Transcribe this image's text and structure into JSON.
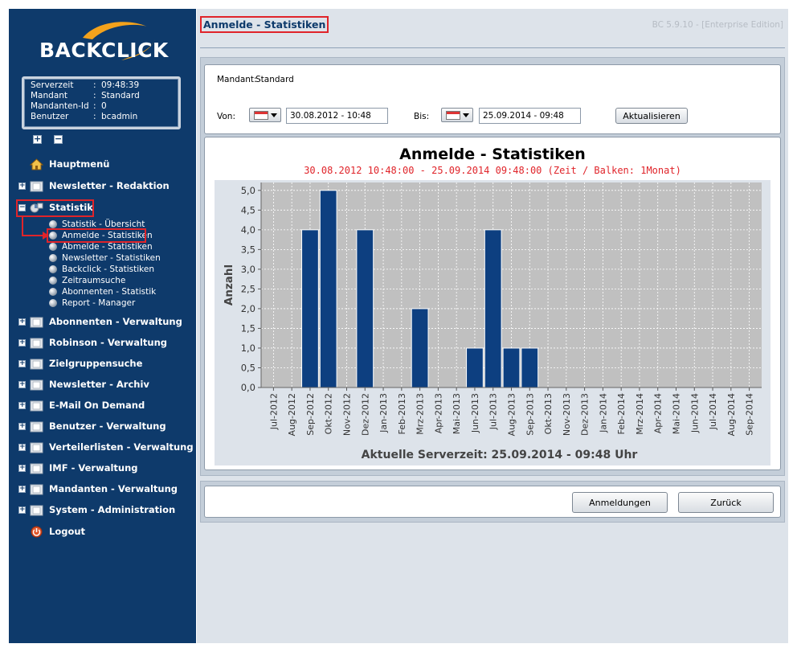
{
  "app": {
    "logo_text": "BACKCLICK",
    "version": "BC 5.9.10 - [Enterprise Edition]"
  },
  "info": [
    {
      "key": "Serverzeit",
      "value": "09:48:39"
    },
    {
      "key": "Mandant",
      "value": "Standard"
    },
    {
      "key": "Mandanten-Id",
      "value": "0"
    },
    {
      "key": "Benutzer",
      "value": "bcadmin"
    }
  ],
  "nav": {
    "home": "Hauptmenü",
    "newsletter_redaktion": "Newsletter - Redaktion",
    "statistik": "Statistik",
    "statistik_sub": [
      "Statistik - Übersicht",
      "Anmelde - Statistiken",
      "Abmelde - Statistiken",
      "Newsletter - Statistiken",
      "Backclick - Statistiken",
      "Zeitraumsuche",
      "Abonnenten - Statistik",
      "Report - Manager"
    ],
    "items": [
      "Abonnenten - Verwaltung",
      "Robinson - Verwaltung",
      "Zielgruppensuche",
      "Newsletter - Archiv",
      "E-Mail On Demand",
      "Benutzer - Verwaltung",
      "Verteilerlisten - Verwaltung",
      "IMF - Verwaltung",
      "Mandanten - Verwaltung",
      "System - Administration"
    ],
    "logout": "Logout"
  },
  "page": {
    "title": "Anmelde - Statistiken"
  },
  "filter": {
    "mandant_label": "Mandant:",
    "mandant_value": "Standard",
    "von_label": "Von:",
    "von_value": "30.08.2012 - 10:48",
    "bis_label": "Bis:",
    "bis_value": "25.09.2014 - 09:48",
    "refresh_label": "Aktualisieren"
  },
  "buttons": {
    "anmeldungen": "Anmeldungen",
    "zurueck": "Zurück"
  },
  "colors": {
    "sidebar": "#0e3a6b",
    "bar": "#0d3f80",
    "plot_bg": "#c0c0c0",
    "subtitle": "#e0242a"
  },
  "chart_data": {
    "type": "bar",
    "title": "Anmelde - Statistiken",
    "subtitle": "30.08.2012 10:48:00 - 25.09.2014 09:48:00  (Zeit / Balken: 1Monat)",
    "ylabel": "Anzahl",
    "xlabel": "Aktuelle Serverzeit: 25.09.2014 - 09:48 Uhr",
    "ylim": [
      0,
      5.2
    ],
    "yticks": [
      "0,0",
      "0,5",
      "1,0",
      "1,5",
      "2,0",
      "2,5",
      "3,0",
      "3,5",
      "4,0",
      "4,5",
      "5,0"
    ],
    "categories": [
      "Jul-2012",
      "Aug-2012",
      "Sep-2012",
      "Okt-2012",
      "Nov-2012",
      "Dez-2012",
      "Jan-2013",
      "Feb-2013",
      "Mrz-2013",
      "Apr-2013",
      "Mai-2013",
      "Jun-2013",
      "Jul-2013",
      "Aug-2013",
      "Sep-2013",
      "Okt-2013",
      "Nov-2013",
      "Dez-2013",
      "Jan-2014",
      "Feb-2014",
      "Mrz-2014",
      "Apr-2014",
      "Mai-2014",
      "Jun-2014",
      "Jul-2014",
      "Aug-2014",
      "Sep-2014"
    ],
    "values": [
      0,
      0,
      4,
      5,
      0,
      4,
      0,
      0,
      2,
      0,
      0,
      1,
      4,
      1,
      1,
      0,
      0,
      0,
      0,
      0,
      0,
      0,
      0,
      0,
      0,
      0,
      0
    ],
    "grid": true
  }
}
